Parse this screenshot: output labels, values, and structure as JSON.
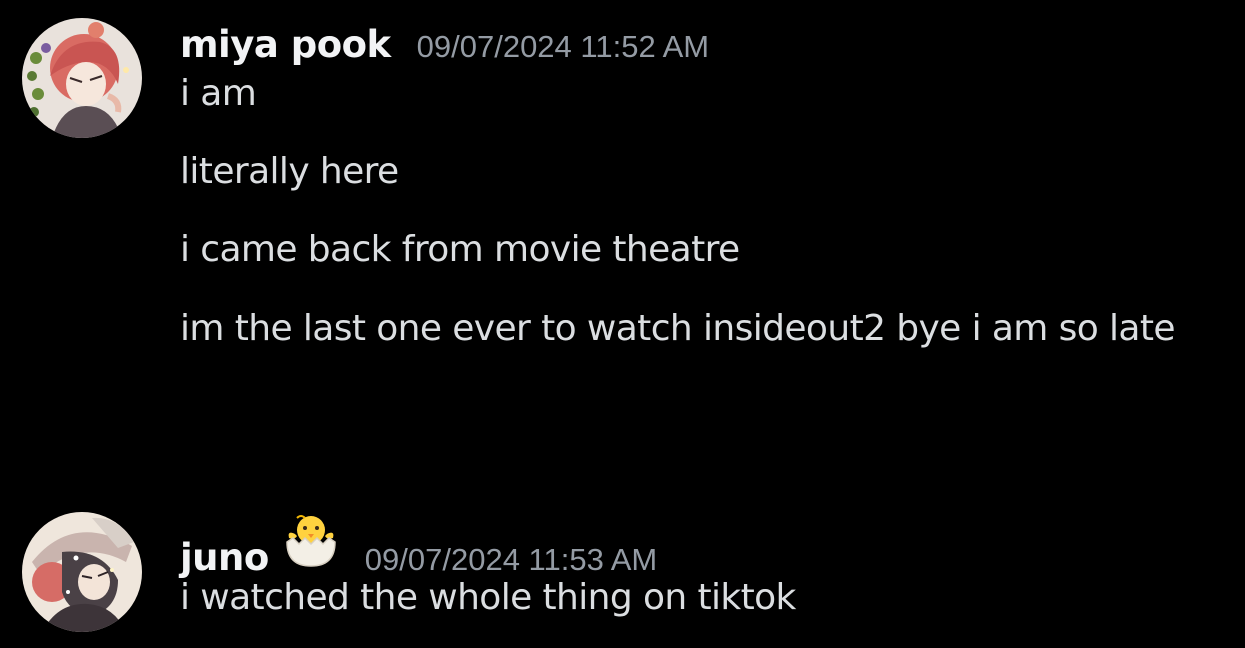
{
  "messages": [
    {
      "author": "miya pook",
      "timestamp": "09/07/2024 11:52 AM",
      "lines": [
        "i am",
        "literally here",
        "i came back from movie theatre",
        "im the last one ever to watch insideout2 bye i am so late"
      ]
    },
    {
      "author": "juno",
      "badge_emoji": "hatching-chick",
      "timestamp": "09/07/2024 11:53 AM",
      "lines": [
        "i watched the whole thing on tiktok"
      ]
    }
  ]
}
